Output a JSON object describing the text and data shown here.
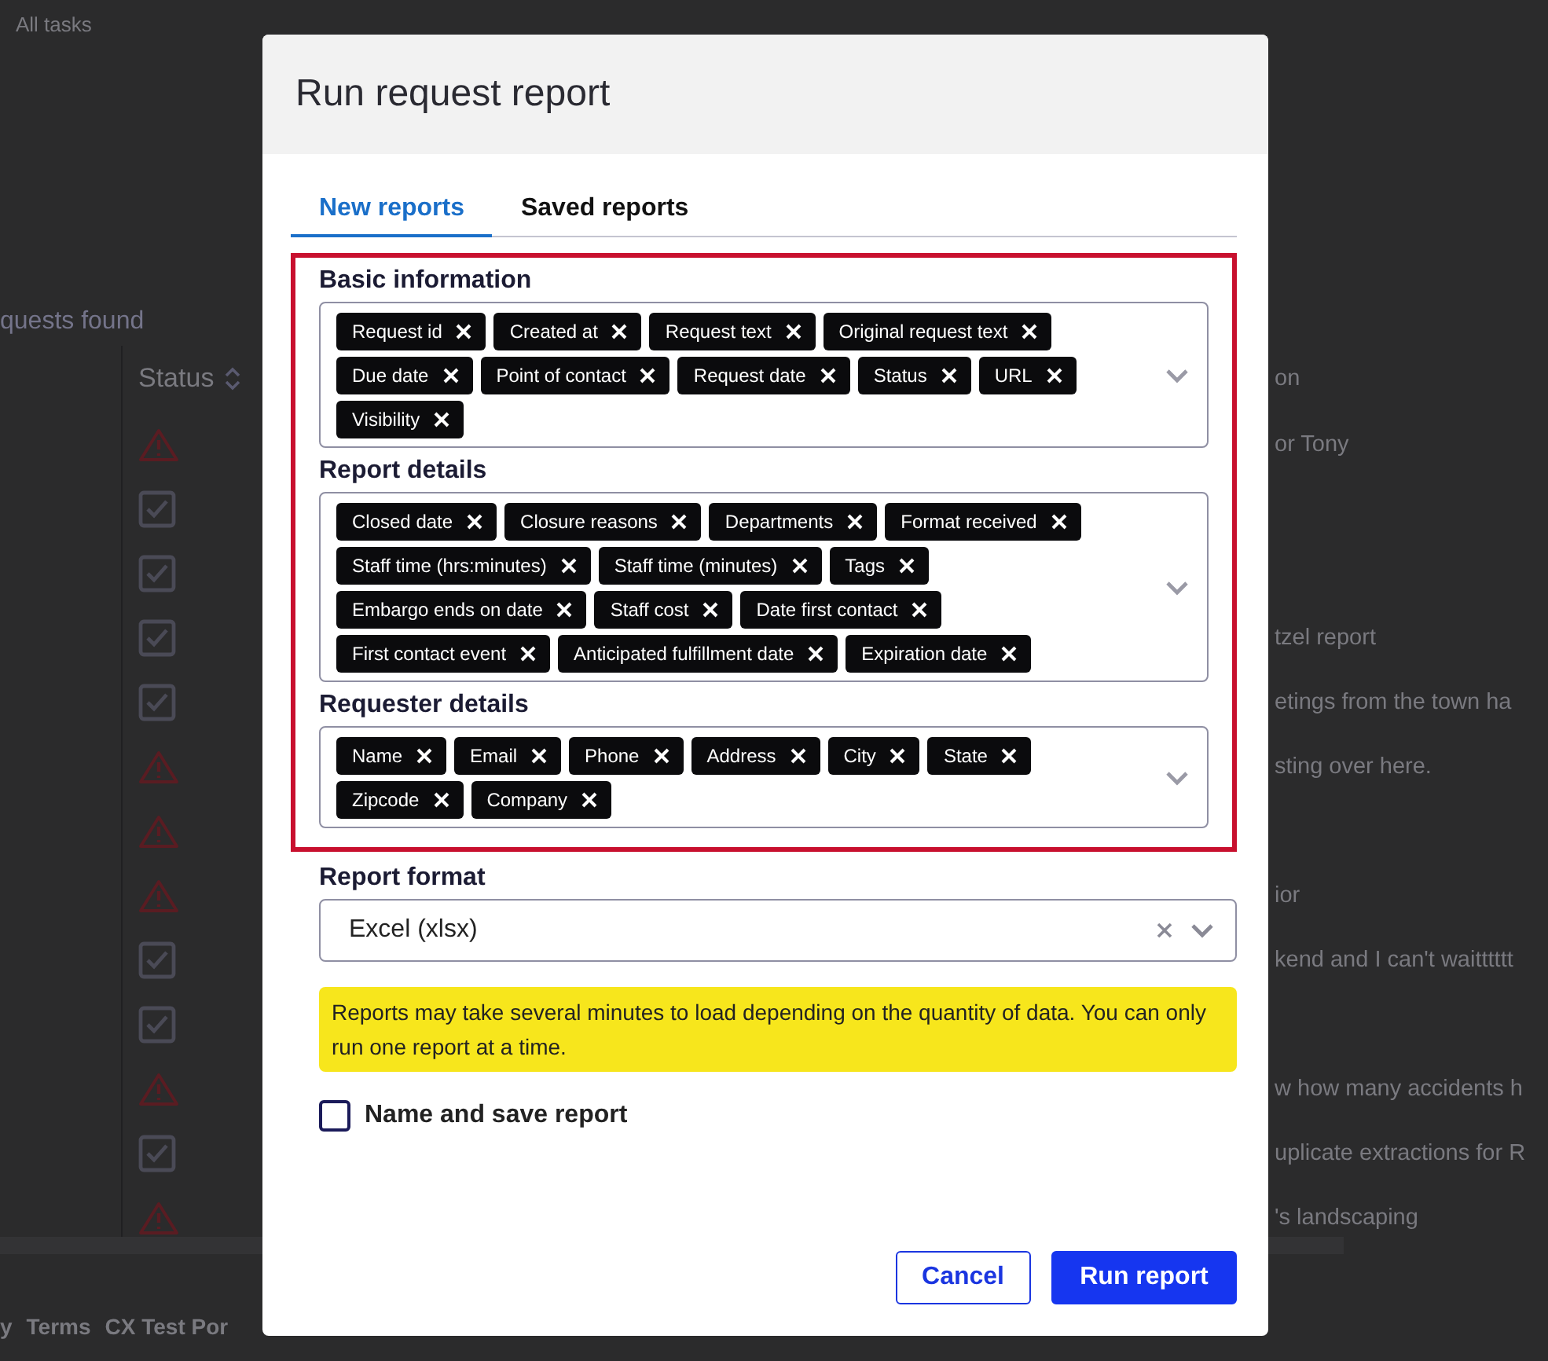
{
  "page": {
    "breadcrumb": "All tasks",
    "results_label": "quests found",
    "table": {
      "columns": [
        {
          "label": "Status",
          "sortable": true
        },
        {
          "label": "on",
          "sortable": false
        }
      ],
      "rows": [
        {
          "kind": "warning",
          "text": "or Tony"
        },
        {
          "kind": "done"
        },
        {
          "kind": "done"
        },
        {
          "kind": "done",
          "text": "tzel report"
        },
        {
          "kind": "done",
          "text": "etings from the town ha"
        },
        {
          "kind": "warning",
          "text": "sting over here."
        },
        {
          "kind": "warning"
        },
        {
          "kind": "warning",
          "text": "ior"
        },
        {
          "kind": "done",
          "text": "kend and I can't waitttttt"
        },
        {
          "kind": "done"
        },
        {
          "kind": "warning",
          "text": "w how many accidents h"
        },
        {
          "kind": "done",
          "text": "uplicate extractions for R"
        },
        {
          "kind": "warning",
          "text": "'s landscaping"
        }
      ]
    },
    "footer_links": [
      "y",
      "Terms",
      "CX Test Por"
    ]
  },
  "dialog": {
    "title": "Run request report",
    "tabs": [
      {
        "label": "New reports",
        "selected": true
      },
      {
        "label": "Saved reports",
        "selected": false
      }
    ],
    "fields_highlighted": true,
    "field_groups": [
      {
        "label": "Basic information",
        "chips": [
          "Request id",
          "Created at",
          "Request text",
          "Original request text",
          "Due date",
          "Point of contact",
          "Request date",
          "Status",
          "URL",
          "Visibility"
        ]
      },
      {
        "label": "Report details",
        "chips": [
          "Closed date",
          "Closure reasons",
          "Departments",
          "Format received",
          "Staff time (hrs:minutes)",
          "Staff time (minutes)",
          "Tags",
          "Embargo ends on date",
          "Staff cost",
          "Date first contact",
          "First contact event",
          "Anticipated fulfillment date",
          "Expiration date"
        ]
      },
      {
        "label": "Requester details",
        "chips": [
          "Name",
          "Email",
          "Phone",
          "Address",
          "City",
          "State",
          "Zipcode",
          "Company"
        ]
      }
    ],
    "report_format": {
      "label": "Report format",
      "value": "Excel (xlsx)"
    },
    "notice": "Reports may take several minutes to load depending on the quantity of data. You can only run one report at a time.",
    "save_option": {
      "label": "Name and save report",
      "checked": false
    },
    "buttons": [
      {
        "label": "Cancel",
        "kind": "secondary"
      },
      {
        "label": "Run report",
        "kind": "primary"
      }
    ]
  }
}
